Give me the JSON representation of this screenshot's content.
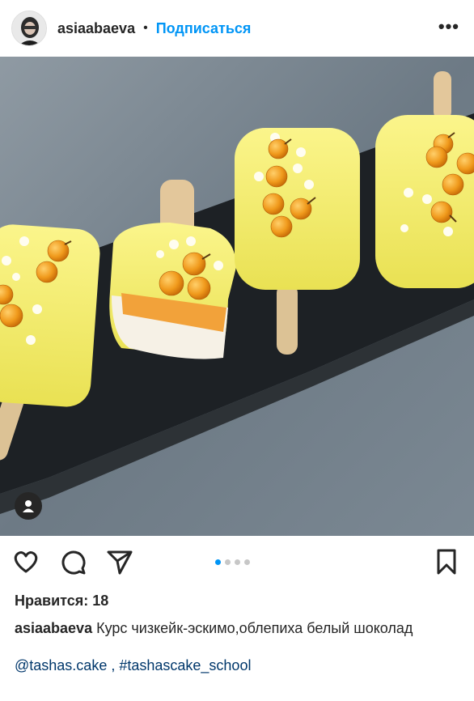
{
  "header": {
    "username": "asiaabaeva",
    "separator": "•",
    "follow_label": "Подписаться",
    "more_icon": "•••"
  },
  "post": {
    "image_description_icon": "photo",
    "carousel": {
      "count": 4,
      "active_index": 0
    }
  },
  "likes": {
    "label": "Нравится: 18"
  },
  "caption": {
    "username": "asiaabaeva",
    "text": "Курс чизкейк-эскимо,облепиха белый шоколад",
    "mention": "@tashas.cake",
    "sep": " , ",
    "hashtag": "#tashascake_school"
  },
  "colors": {
    "accent": "#0095f6",
    "link": "#00376b",
    "text": "#262626"
  }
}
